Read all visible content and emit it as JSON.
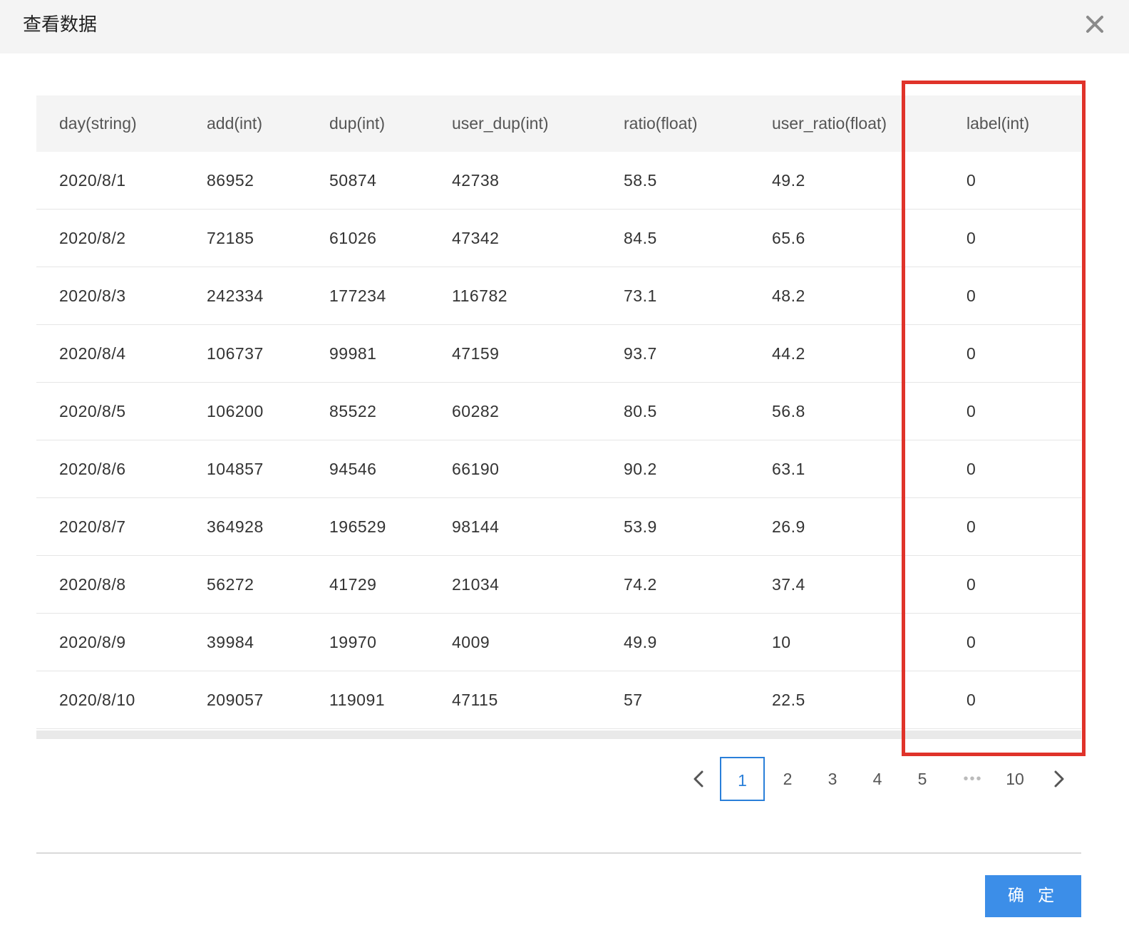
{
  "dialog": {
    "title": "查看数据",
    "close_icon": "close-icon",
    "confirm_label": "确 定"
  },
  "table": {
    "columns": [
      "day(string)",
      "add(int)",
      "dup(int)",
      "user_dup(int)",
      "ratio(float)",
      "user_ratio(float)",
      "label(int)"
    ],
    "rows": [
      [
        "2020/8/1",
        "86952",
        "50874",
        "42738",
        "58.5",
        "49.2",
        "0"
      ],
      [
        "2020/8/2",
        "72185",
        "61026",
        "47342",
        "84.5",
        "65.6",
        "0"
      ],
      [
        "2020/8/3",
        "242334",
        "177234",
        "116782",
        "73.1",
        "48.2",
        "0"
      ],
      [
        "2020/8/4",
        "106737",
        "99981",
        "47159",
        "93.7",
        "44.2",
        "0"
      ],
      [
        "2020/8/5",
        "106200",
        "85522",
        "60282",
        "80.5",
        "56.8",
        "0"
      ],
      [
        "2020/8/6",
        "104857",
        "94546",
        "66190",
        "90.2",
        "63.1",
        "0"
      ],
      [
        "2020/8/7",
        "364928",
        "196529",
        "98144",
        "53.9",
        "26.9",
        "0"
      ],
      [
        "2020/8/8",
        "56272",
        "41729",
        "21034",
        "74.2",
        "37.4",
        "0"
      ],
      [
        "2020/8/9",
        "39984",
        "19970",
        "4009",
        "49.9",
        "10",
        "0"
      ],
      [
        "2020/8/10",
        "209057",
        "119091",
        "47115",
        "57",
        "22.5",
        "0"
      ]
    ]
  },
  "pagination": {
    "prev_icon": "chevron-left-icon",
    "next_icon": "chevron-right-icon",
    "pages": [
      "1",
      "2",
      "3",
      "4",
      "5"
    ],
    "current_page": "1",
    "ellipsis": "•••",
    "last_page": "10"
  },
  "annotation": {
    "highlight_color": "#e0332a"
  },
  "colors": {
    "accent": "#2a7fd9",
    "button": "#3c8ee8",
    "header_bg": "#f4f4f4"
  }
}
